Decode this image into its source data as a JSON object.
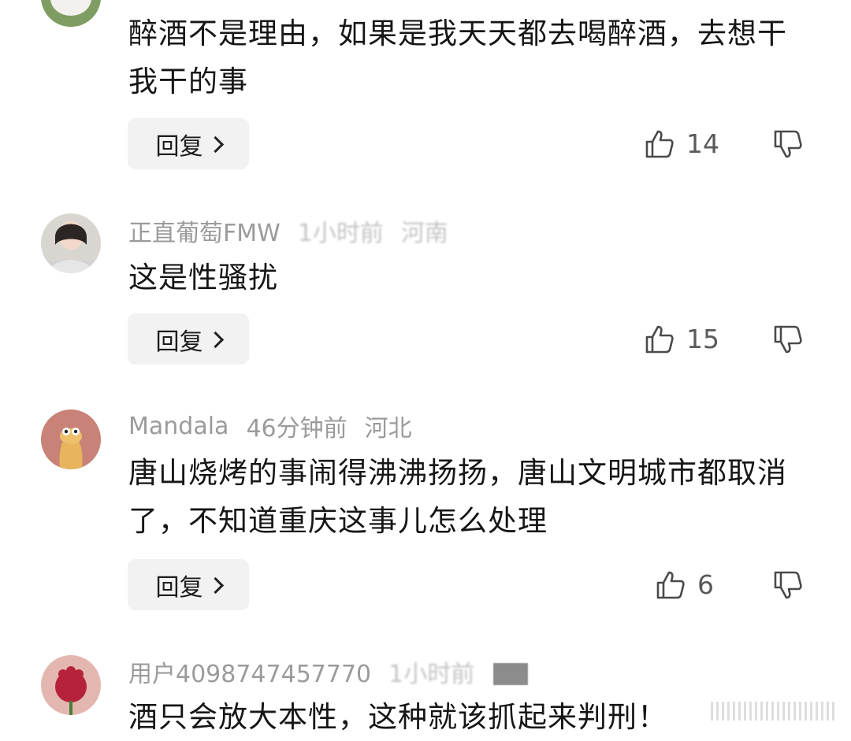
{
  "comments": [
    {
      "user": "",
      "time": "",
      "location": "",
      "text": "醉酒不是理由，如果是我天天都去喝醉酒，去想干我干的事",
      "reply_label": "回复",
      "likes": "14"
    },
    {
      "user": "正直葡萄FMW",
      "time": "1小时前",
      "location": "河南",
      "text": "这是性骚扰",
      "reply_label": "回复",
      "likes": "15"
    },
    {
      "user": "Mandala",
      "time": "46分钟前",
      "location": "河北",
      "text": "唐山烧烤的事闹得沸沸扬扬，唐山文明城市都取消了，不知道重庆这事儿怎么处理",
      "reply_label": "回复",
      "likes": "6"
    },
    {
      "user": "用户4098747457770",
      "time": "1小时前",
      "location": "",
      "text": "酒只会放大本性，这种就该抓起来判刑！",
      "reply_label": "",
      "likes": ""
    }
  ],
  "icons": {
    "like": "thumbs-up-icon",
    "dislike": "thumbs-down-icon",
    "reply_chevron": "chevron-right-icon"
  },
  "colors": {
    "meta_text": "#9b9b9b",
    "reply_bg": "#f2f2f2",
    "body_text": "#161616"
  }
}
